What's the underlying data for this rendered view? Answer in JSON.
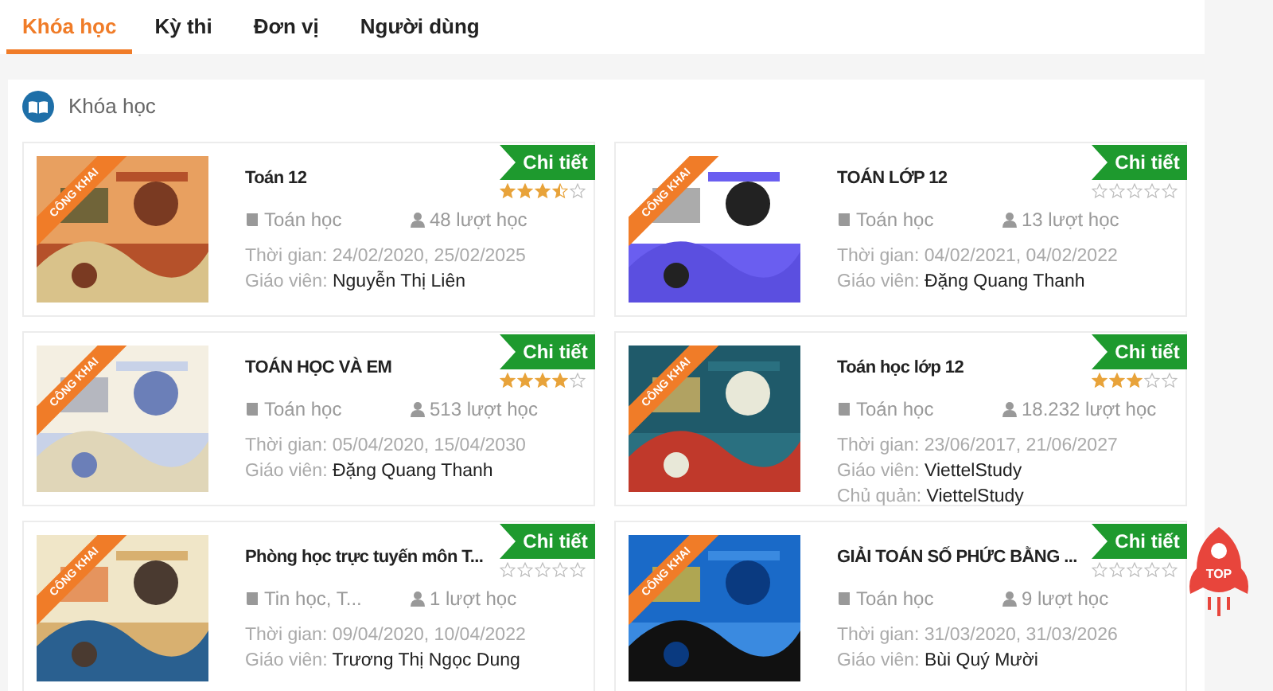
{
  "tabs": [
    {
      "label": "Khóa học",
      "selected": true
    },
    {
      "label": "Kỳ thi",
      "selected": false
    },
    {
      "label": "Đơn vị",
      "selected": false
    },
    {
      "label": "Người dùng",
      "selected": false
    }
  ],
  "section": {
    "title": "Khóa học"
  },
  "courses": [
    {
      "title": "Toán 12",
      "ribbon": "CÔNG KHAI",
      "button": "Chi tiết",
      "stars": 3.5,
      "category": "Toán học",
      "views": "48 lượt học",
      "details": [
        {
          "label": "Thời gian:",
          "value": "24/02/2020, 25/02/2025",
          "kind": "date"
        },
        {
          "label": "Giáo viên:",
          "value": "Nguyễn Thị Liên",
          "kind": "person"
        }
      ]
    },
    {
      "title": "TOÁN LỚP 12",
      "ribbon": "CÔNG KHAI",
      "button": "Chi tiết",
      "stars": 0,
      "category": "Toán học",
      "views": "13 lượt học",
      "details": [
        {
          "label": "Thời gian:",
          "value": "04/02/2021, 04/02/2022",
          "kind": "date"
        },
        {
          "label": "Giáo viên:",
          "value": "Đặng Quang Thanh",
          "kind": "person"
        }
      ]
    },
    {
      "title": "TOÁN HỌC VÀ EM",
      "ribbon": "CÔNG KHAI",
      "button": "Chi tiết",
      "stars": 4,
      "category": "Toán học",
      "views": "513 lượt học",
      "details": [
        {
          "label": "Thời gian:",
          "value": "05/04/2020, 15/04/2030",
          "kind": "date"
        },
        {
          "label": "Giáo viên:",
          "value": "Đặng Quang Thanh",
          "kind": "person"
        }
      ]
    },
    {
      "title": "Toán học lớp 12",
      "ribbon": "CÔNG KHAI",
      "button": "Chi tiết",
      "stars": 3,
      "category": "Toán học",
      "views": "18.232 lượt học",
      "details": [
        {
          "label": "Thời gian:",
          "value": "23/06/2017, 21/06/2027",
          "kind": "date"
        },
        {
          "label": "Giáo viên:",
          "value": "ViettelStudy",
          "kind": "person"
        },
        {
          "label": "Chủ quản:",
          "value": "ViettelStudy",
          "kind": "person"
        }
      ]
    },
    {
      "title": "Phòng học trực tuyến môn T...",
      "ribbon": "CÔNG KHAI",
      "button": "Chi tiết",
      "stars": 0,
      "category": "Tin học, T...",
      "views": "1 lượt học",
      "details": [
        {
          "label": "Thời gian:",
          "value": "09/04/2020, 10/04/2022",
          "kind": "date"
        },
        {
          "label": "Giáo viên:",
          "value": "Trương Thị Ngọc Dung",
          "kind": "person"
        }
      ]
    },
    {
      "title": "GIẢI TOÁN SỐ PHỨC BẰNG ...",
      "ribbon": "CÔNG KHAI",
      "button": "Chi tiết",
      "stars": 0,
      "category": "Toán học",
      "views": "9 lượt học",
      "details": [
        {
          "label": "Thời gian:",
          "value": "31/03/2020, 31/03/2026",
          "kind": "date"
        },
        {
          "label": "Giáo viên:",
          "value": "Bùi Quý Mười",
          "kind": "person"
        }
      ]
    }
  ],
  "top_button": {
    "label": "TOP"
  }
}
